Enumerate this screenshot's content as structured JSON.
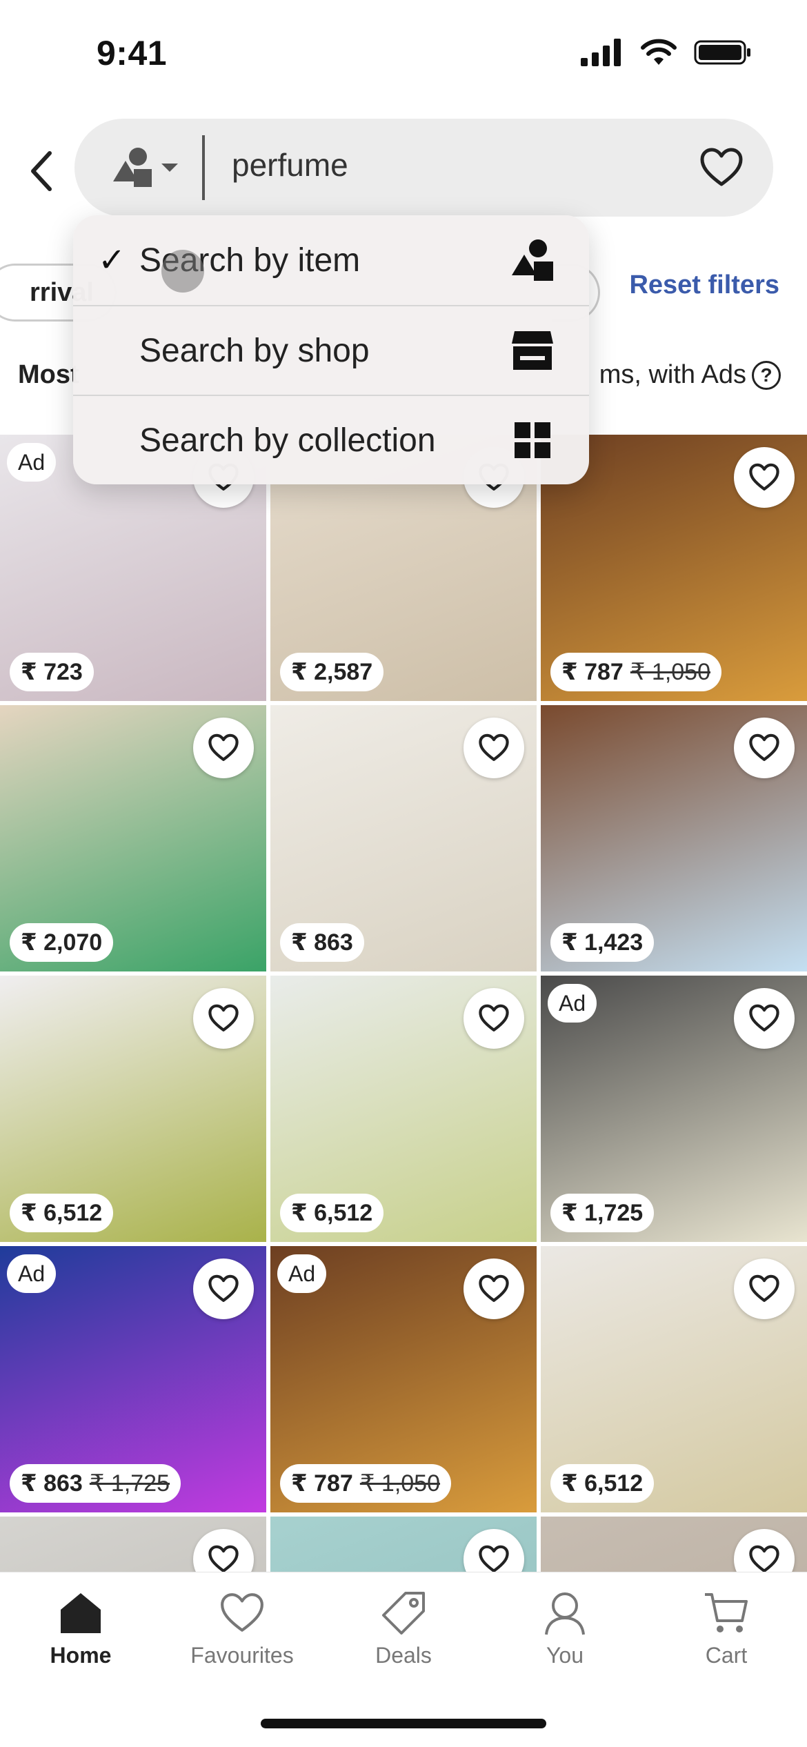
{
  "status": {
    "time": "9:41"
  },
  "search": {
    "query": "perfume"
  },
  "filters": {
    "chip_label": "rrival",
    "reset_label": "Reset filters"
  },
  "sort": {
    "label": "Most",
    "results_note": "ms, with Ads"
  },
  "dropdown": {
    "items": [
      {
        "label": "Search by item",
        "checked": "✓",
        "icon": "shapes-icon"
      },
      {
        "label": "Search by shop",
        "checked": "",
        "icon": "storefront-icon"
      },
      {
        "label": "Search by collection",
        "checked": "",
        "icon": "grid-icon"
      }
    ]
  },
  "listings": [
    {
      "price": "₹ 723",
      "old_price": "",
      "ad": "Ad",
      "colors": [
        "#e9e6ea",
        "#c9b7c0"
      ]
    },
    {
      "price": "₹ 2,587",
      "old_price": "",
      "ad": "",
      "colors": [
        "#e6dccd",
        "#cdbfa8"
      ]
    },
    {
      "price": "₹ 787",
      "old_price": "₹ 1,050",
      "ad": "",
      "colors": [
        "#6d3f22",
        "#d99c3c"
      ]
    },
    {
      "price": "₹ 2,070",
      "old_price": "",
      "ad": "",
      "colors": [
        "#e5d5c0",
        "#3aa367"
      ]
    },
    {
      "price": "₹ 863",
      "old_price": "",
      "ad": "",
      "colors": [
        "#efece6",
        "#d9d2c2"
      ]
    },
    {
      "price": "₹ 1,423",
      "old_price": "",
      "ad": "",
      "colors": [
        "#7a4a2e",
        "#c4dff2"
      ]
    },
    {
      "price": "₹ 6,512",
      "old_price": "",
      "ad": "",
      "colors": [
        "#f0eef0",
        "#a9b24a"
      ]
    },
    {
      "price": "₹ 6,512",
      "old_price": "",
      "ad": "",
      "colors": [
        "#e9ecea",
        "#c7d08a"
      ]
    },
    {
      "price": "₹ 1,725",
      "old_price": "",
      "ad": "Ad",
      "colors": [
        "#4a4a4a",
        "#e8e4d0"
      ]
    },
    {
      "price": "₹ 863",
      "old_price": "₹ 1,725",
      "ad": "Ad",
      "colors": [
        "#1f3c9a",
        "#c23be0"
      ]
    },
    {
      "price": "₹ 787",
      "old_price": "₹ 1,050",
      "ad": "Ad",
      "colors": [
        "#6d3f22",
        "#d99c3c"
      ]
    },
    {
      "price": "₹ 6,512",
      "old_price": "",
      "ad": "",
      "colors": [
        "#ebe8e4",
        "#d4c9a0"
      ]
    },
    {
      "price": "",
      "old_price": "",
      "ad": "",
      "colors": [
        "#d5d4d0",
        "#b9b5ae"
      ]
    },
    {
      "price": "",
      "old_price": "",
      "ad": "",
      "colors": [
        "#a7d1cf",
        "#8bbab8"
      ]
    },
    {
      "price": "",
      "old_price": "",
      "ad": "",
      "colors": [
        "#c7bdb2",
        "#b4a899"
      ]
    }
  ],
  "tabbar": {
    "tabs": [
      {
        "label": "Home",
        "icon": "home-icon",
        "active": true
      },
      {
        "label": "Favourites",
        "icon": "heart-icon",
        "active": false
      },
      {
        "label": "Deals",
        "icon": "tag-icon",
        "active": false
      },
      {
        "label": "You",
        "icon": "person-icon",
        "active": false
      },
      {
        "label": "Cart",
        "icon": "cart-icon",
        "active": false
      }
    ]
  },
  "theme": {
    "accent": "#3b5bab",
    "text": "#222222",
    "muted": "#777777"
  }
}
